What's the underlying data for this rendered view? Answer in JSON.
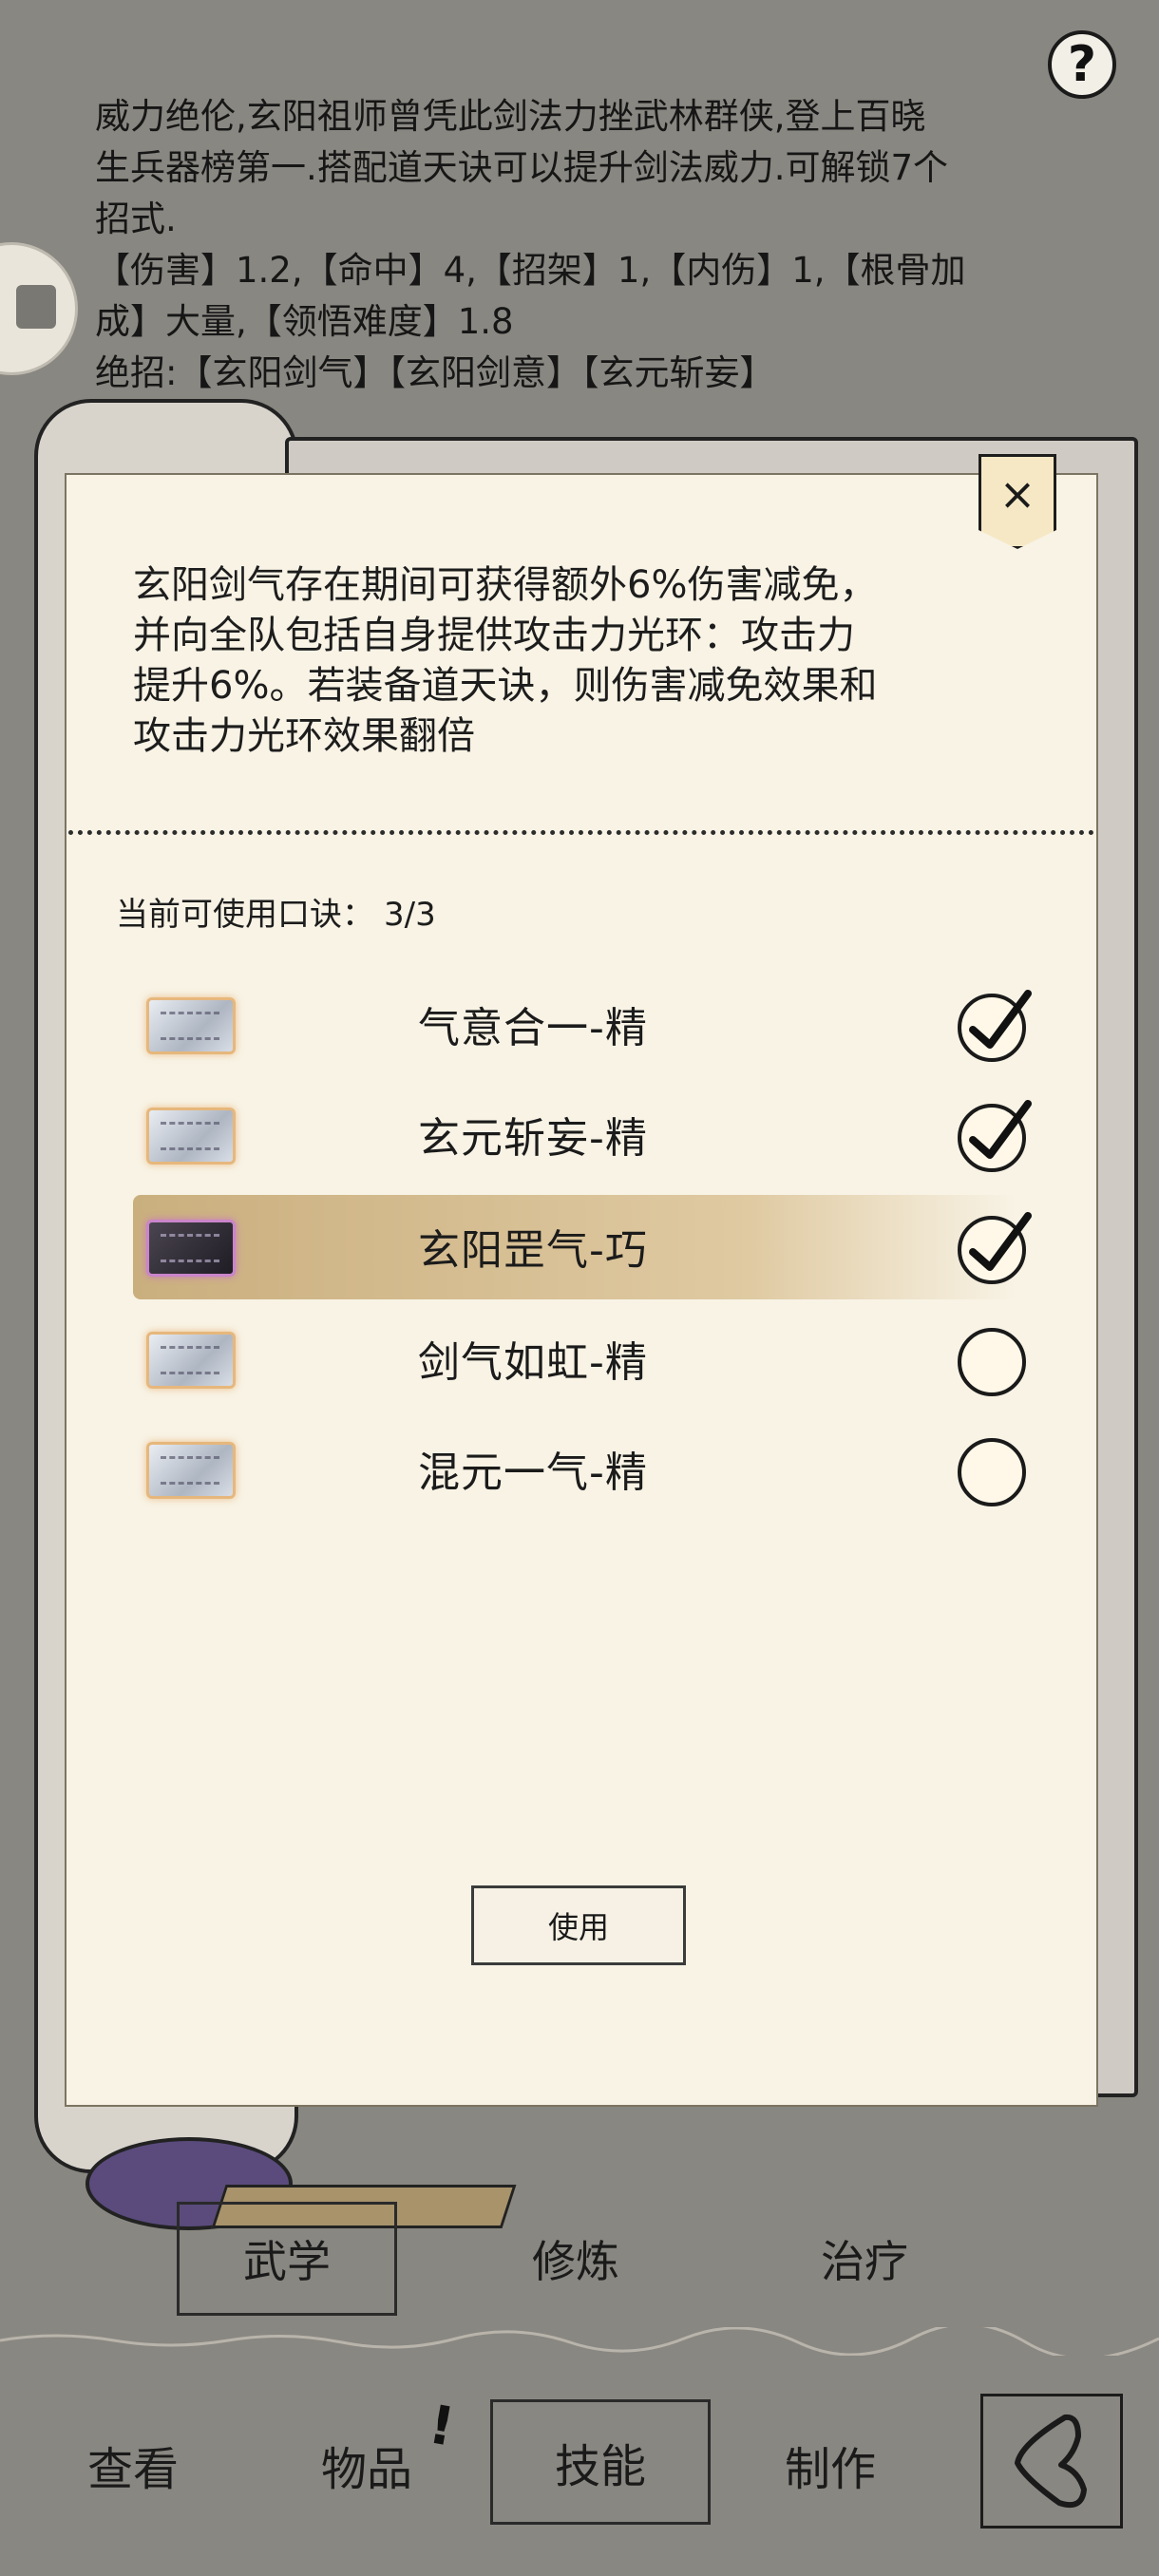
{
  "help": {
    "label": "?"
  },
  "description": {
    "line1": "威力绝伦,玄阳祖师曾凭此剑法力挫武林群侠,登上百晓",
    "line2": "生兵器榜第一.搭配道天诀可以提升剑法威力.可解锁7个",
    "line3": "招式.",
    "line4": "【伤害】1.2,【命中】4,【招架】1,【内伤】1,【根骨加",
    "line5": "成】大量,【领悟难度】1.8",
    "line6": "绝招:【玄阳剑气】【玄阳剑意】【玄元斩妄】"
  },
  "dialog": {
    "close_label": "×",
    "effect_line1": "玄阳剑气存在期间可获得额外6%伤害减免，",
    "effect_line2": "并向全队包括自身提供攻击力光环：攻击力",
    "effect_line3": "提升6%。若装备道天诀，则伤害减免效果和",
    "effect_line4": "攻击力光环效果翻倍",
    "count_label": "当前可使用口诀：",
    "count_value": "3/3",
    "items": [
      {
        "name": "气意合一-精",
        "checked": true,
        "plate": "silver"
      },
      {
        "name": "玄元斩妄-精",
        "checked": true,
        "plate": "silver"
      },
      {
        "name": "玄阳罡气-巧",
        "checked": true,
        "plate": "dark",
        "highlighted": true
      },
      {
        "name": "剑气如虹-精",
        "checked": false,
        "plate": "silver"
      },
      {
        "name": "混元一气-精",
        "checked": false,
        "plate": "silver"
      }
    ],
    "use_button": "使用"
  },
  "subtabs": {
    "martial": "武学",
    "cultivate": "修炼",
    "heal": "治疗"
  },
  "nav": {
    "view": "查看",
    "items": "物品",
    "items_badge": "!",
    "skills": "技能",
    "craft": "制作"
  },
  "icons": {
    "help": "question-icon",
    "close": "close-icon",
    "check": "checkmark-icon",
    "back": "back-arrow-icon"
  },
  "colors": {
    "panel": "#f8f3e5",
    "highlight": "#c2a36c",
    "background": "#898781"
  }
}
